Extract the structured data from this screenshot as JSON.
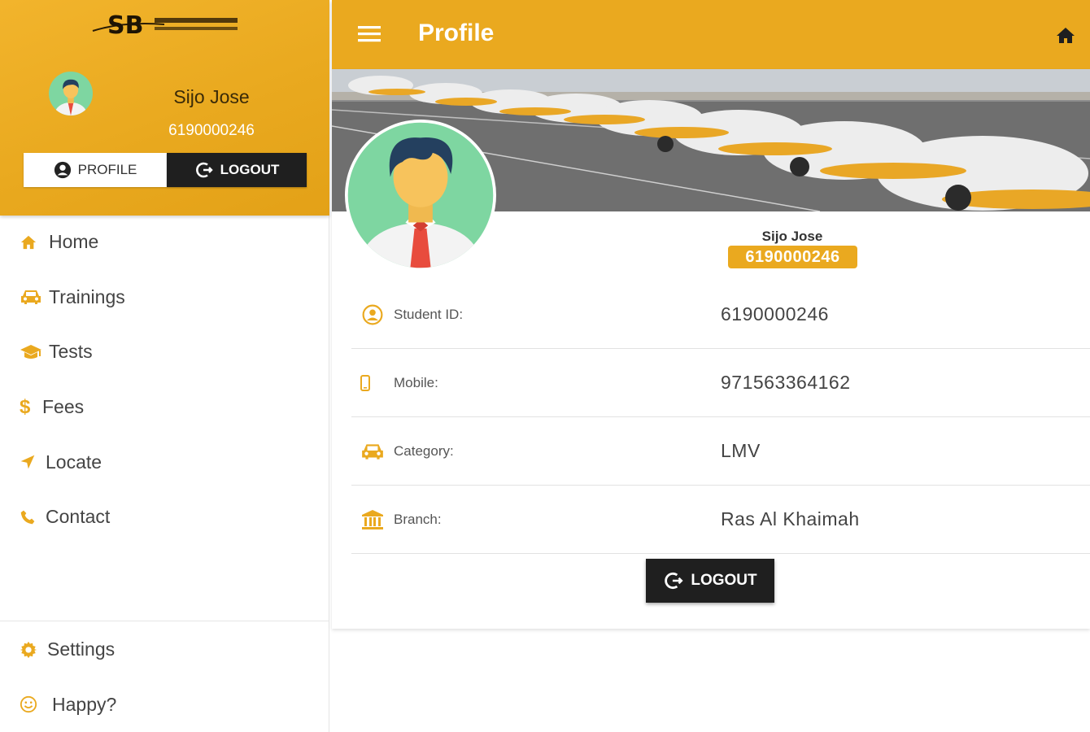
{
  "header": {
    "title": "Profile"
  },
  "drawer": {
    "user_name": "Sijo Jose",
    "user_phone": "6190000246",
    "profile_button": "PROFILE",
    "logout_button": "LOGOUT"
  },
  "sidebar": {
    "items": [
      {
        "label": "Home",
        "icon": "home-icon"
      },
      {
        "label": "Trainings",
        "icon": "car-icon"
      },
      {
        "label": "Tests",
        "icon": "graduation-cap-icon"
      },
      {
        "label": "Fees",
        "icon": "dollar-icon"
      },
      {
        "label": "Locate",
        "icon": "location-arrow-icon"
      },
      {
        "label": "Contact",
        "icon": "phone-icon"
      }
    ],
    "bottom_items": [
      {
        "label": "Settings",
        "icon": "gear-icon"
      },
      {
        "label": "Happy?",
        "icon": "smile-icon"
      }
    ]
  },
  "profile": {
    "name": "Sijo Jose",
    "student_id_badge": "6190000246",
    "fields": [
      {
        "label": "Student ID:",
        "value": "6190000246",
        "icon": "user-circle-icon"
      },
      {
        "label": "Mobile:",
        "value": "971563364162",
        "icon": "mobile-icon"
      },
      {
        "label": "Category:",
        "value": "LMV",
        "icon": "car-icon"
      },
      {
        "label": "Branch:",
        "value": "Ras Al Khaimah",
        "icon": "bank-icon"
      }
    ],
    "logout_button": "LOGOUT"
  },
  "colors": {
    "accent": "#eaa91f",
    "dark_button": "#1f1f1f",
    "avatar_bg": "#7ed6a1"
  }
}
